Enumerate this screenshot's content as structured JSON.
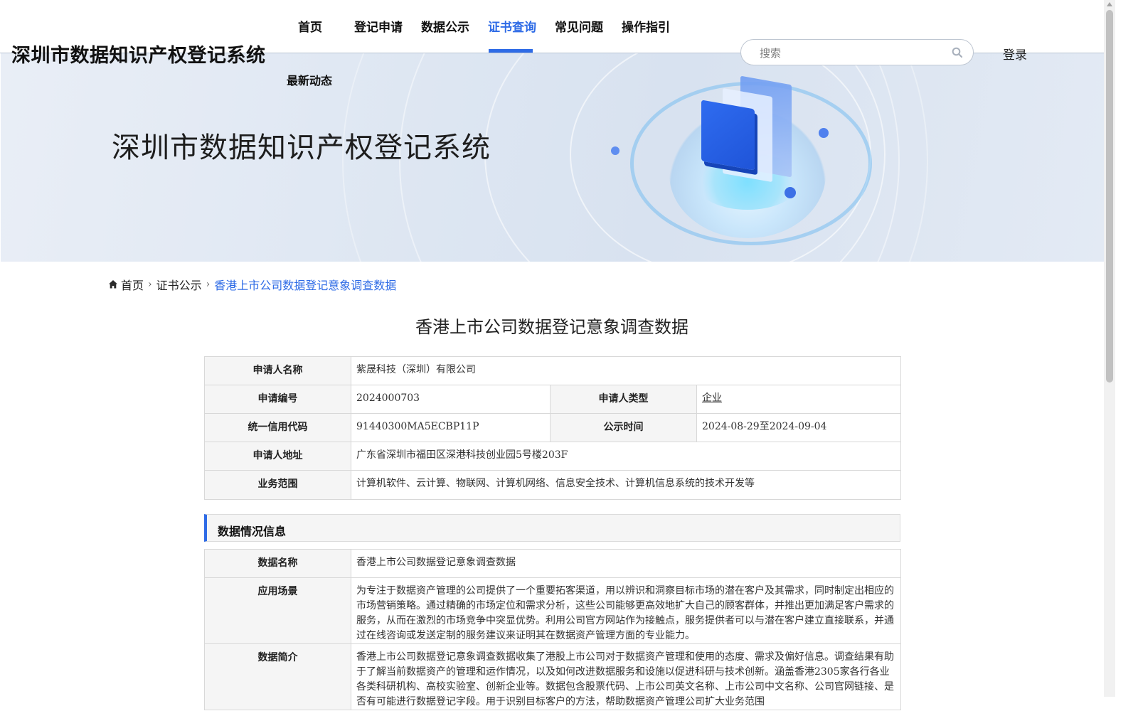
{
  "header": {
    "brand": "深圳市数据知识产权登记系统",
    "nav": [
      "首页",
      "登记申请",
      "数据公示",
      "证书查询",
      "常见问题",
      "操作指引",
      "最新动态"
    ],
    "active_nav": "证书查询",
    "search_placeholder": "搜索",
    "search_icon": "search-icon",
    "login_label": "登录"
  },
  "banner": {
    "title": "深圳市数据知识产权登记系统"
  },
  "breadcrumb": {
    "home_icon": "home-icon",
    "home": "首页",
    "level2": "证书公示",
    "current": "香港上市公司数据登记意象调查数据"
  },
  "page_title": "香港上市公司数据登记意象调查数据",
  "applicant": {
    "name_label": "申请人名称",
    "name": "紫晟科技（深圳）有限公司",
    "number_label": "申请编号",
    "number": "2024000703",
    "type_label": "申请人类型",
    "type": "企业",
    "credit_label": "统一信用代码",
    "credit": "91440300MA5ECBP11P",
    "publicity_label": "公示时间",
    "publicity": "2024-08-29至2024-09-04",
    "address_label": "申请人地址",
    "address": "广东省深圳市福田区深港科技创业园5号楼203F",
    "scope_label": "业务范围",
    "scope": "计算机软件、云计算、物联网、计算机网络、信息安全技术、计算机信息系统的技术开发等"
  },
  "data_section": {
    "heading": "数据情况信息",
    "name_label": "数据名称",
    "name": "香港上市公司数据登记意象调查数据",
    "scenario_label": "应用场景",
    "scenario": "为专注于数据资产管理的公司提供了一个重要拓客渠道，用以辨识和洞察目标市场的潜在客户及其需求，同时制定出相应的市场营销策略。通过精确的市场定位和需求分析，这些公司能够更高效地扩大自己的顾客群体，并推出更加满足客户需求的服务，从而在激烈的市场竞争中突显优势。利用公司官方网站作为接触点，服务提供者可以与潜在客户建立直接联系，并通过在线咨询或发送定制的服务建议来证明其在数据资产管理方面的专业能力。",
    "intro_label": "数据简介",
    "intro": "香港上市公司数据登记意象调查数据收集了港股上市公司对于数据资产管理和使用的态度、需求及偏好信息。调查结果有助于了解当前数据资产的管理和运作情况，以及如何改进数据服务和设施以促进科研与技术创新。涵盖香港2305家各行各业各类科研机构、高校实验室、创新企业等。数据包含股票代码、上市公司英文名称、上市公司中文名称、公司官网链接、是否有可能进行数据登记字段。用于识别目标客户的方法，帮助数据资产管理公司扩大业务范围"
  },
  "colors": {
    "accent": "#2e6be6",
    "label_bg": "#f5f5f5"
  }
}
